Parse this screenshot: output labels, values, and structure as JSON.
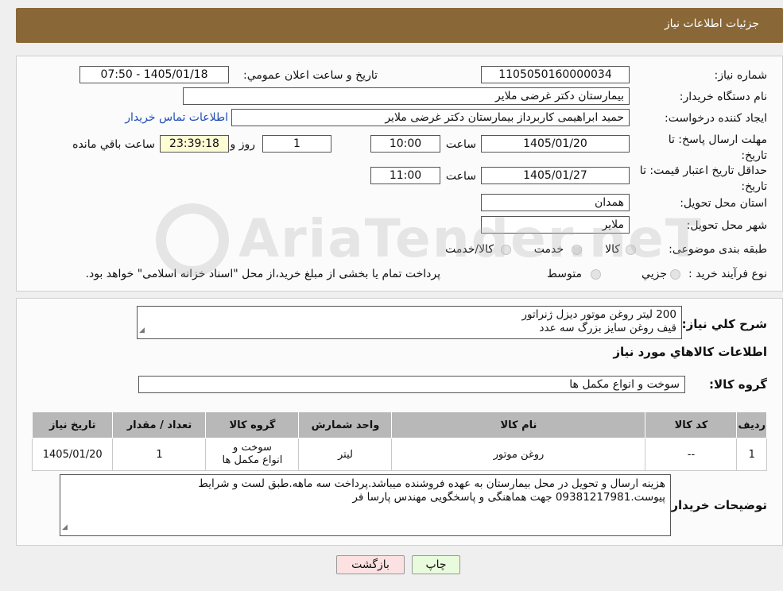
{
  "header": {
    "title": "جزئیات اطلاعات نیاز"
  },
  "form": {
    "need_number_label": "شماره نیاز:",
    "need_number": "1105050160000034",
    "announce_label": "تاریخ و ساعت اعلان عمومي:",
    "announce_value": "1405/01/18 - 07:50",
    "buyer_org_label": "نام دستگاه خریدار:",
    "buyer_org": "بیمارستان دکتر غرضی ملایر",
    "creator_label": "ایجاد کننده درخواست:",
    "creator": "حمید ابراهیمی کاربرداز بیمارستان دکتر غرضی ملایر",
    "contact_link": "اطلاعات تماس خریدار",
    "deadline_label": "مهلت ارسال پاسخ: تا تاریخ:",
    "deadline_date": "1405/01/20",
    "time_label": "ساعت",
    "deadline_time": "10:00",
    "days_value": "1",
    "days_label": "روز و",
    "remaining_time": "23:39:18",
    "remaining_label": "ساعت باقي مانده",
    "validity_label": "حداقل تاریخ اعتبار قیمت: تا تاریخ:",
    "validity_date": "1405/01/27",
    "validity_time": "11:00",
    "province_label": "استان محل تحویل:",
    "province": "همدان",
    "city_label": "شهر محل تحویل:",
    "city": "ملایر",
    "category_label": "طبقه بندی موضوعی:",
    "category_options": [
      "کالا",
      "خدمت",
      "کالا/خدمت"
    ],
    "process_label": "نوع فرآیند خرید :",
    "process_options": [
      "جزیي",
      "متوسط"
    ],
    "process_note": "پرداخت تمام یا بخشی از مبلغ خرید،از محل \"اسناد خزانه اسلامی\" خواهد بود."
  },
  "summary": {
    "desc_label": "شرح کلي نیاز:",
    "desc_lines": [
      "200 لیتر روغن موتور دیزل ژنراتور",
      "قیف روغن سایز بزرگ سه عدد"
    ],
    "goods_info_title": "اطلاعات کالاهاي مورد نیاز",
    "group_label": "گروه کالا:",
    "group_value": "سوخت و انواع مکمل ها",
    "table": {
      "headers": [
        "ردیف",
        "کد کالا",
        "نام کالا",
        "واحد شمارش",
        "گروه کالا",
        "تعداد / مقدار",
        "تاریخ نیاز"
      ],
      "rows": [
        [
          "1",
          "--",
          "روغن موتور",
          "لیتر",
          "سوخت و انواع مکمل ها",
          "1",
          "1405/01/20"
        ]
      ]
    },
    "buyer_notes_label": "توضیحات خریدار:",
    "buyer_notes_lines": [
      "هزینه ارسال و تحویل در محل بیمارستان به عهده فروشنده میباشد.پرداخت سه ماهه.طبق لست و شرایط",
      "پیوست.09381217981 جهت هماهنگی و پاسخگویی مهندس پارسا فر"
    ]
  },
  "buttons": {
    "print": "چاپ",
    "back": "بازگشت"
  },
  "watermark": "AriaTender.neT",
  "colors": {
    "header_bg": "#896736",
    "link": "#1f4db5",
    "print_btn": "#e8fbdc",
    "back_btn": "#fbe1e1",
    "timer_bg": "#fefcd3"
  }
}
